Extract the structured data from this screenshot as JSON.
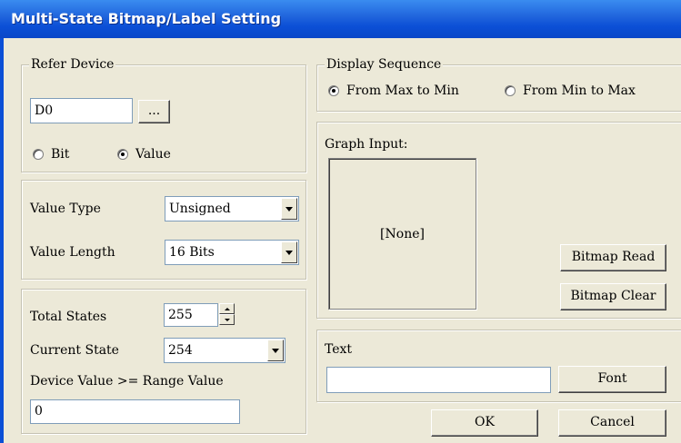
{
  "window": {
    "title": "Multi-State Bitmap/Label Setting"
  },
  "refer_device": {
    "legend": "Refer Device",
    "device_value": "D0",
    "browse_label": "...",
    "radio_bit": "Bit",
    "radio_value": "Value",
    "selected": "Value"
  },
  "value_settings": {
    "value_type_label": "Value Type",
    "value_type_selected": "Unsigned",
    "value_length_label": "Value Length",
    "value_length_selected": "16 Bits"
  },
  "states": {
    "total_states_label": "Total States",
    "total_states_value": "255",
    "current_state_label": "Current State",
    "current_state_selected": "254",
    "range_label": "Device Value >= Range Value",
    "range_value": "0"
  },
  "display_sequence": {
    "legend": "Display Sequence",
    "option_max_to_min": "From Max to Min",
    "option_min_to_max": "From Min to Max",
    "selected": "From Max to Min"
  },
  "graph_input": {
    "label": "Graph Input:",
    "preview_text": "[None]",
    "bitmap_read_label": "Bitmap Read",
    "bitmap_clear_label": "Bitmap Clear"
  },
  "text_section": {
    "label": "Text",
    "text_value": "",
    "font_label": "Font"
  },
  "footer": {
    "ok_label": "OK",
    "cancel_label": "Cancel"
  }
}
